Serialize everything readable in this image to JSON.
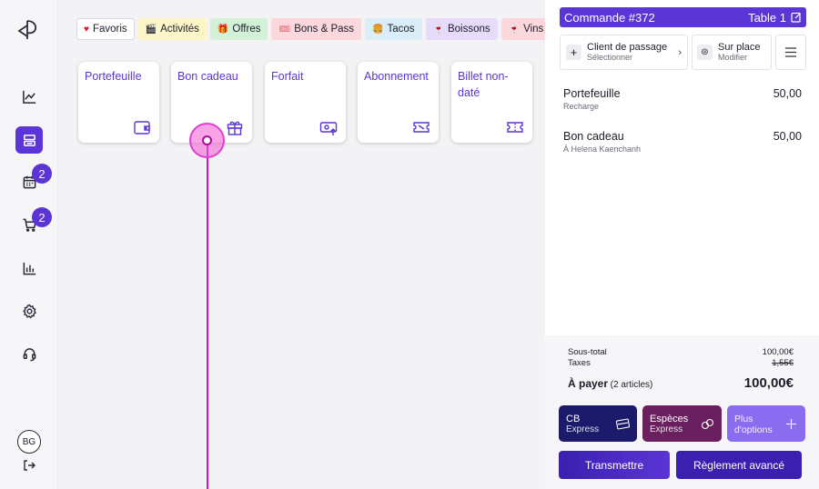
{
  "sidebar": {
    "badges": {
      "calendar": "2",
      "cart": "2"
    },
    "avatar": "BG"
  },
  "tabs": [
    {
      "emoji": "♥",
      "label": "Favoris",
      "bg": "#ffffff",
      "border": "#d9d9e3",
      "emoji_color": "#d11f2a"
    },
    {
      "emoji": "🎬",
      "label": "Activités",
      "bg": "#fdf6c8",
      "border": "#fdf6c8",
      "emoji_color": "#333"
    },
    {
      "emoji": "🎁",
      "label": "Offres",
      "bg": "#d3f1d8",
      "border": "#d3f1d8",
      "emoji_color": "#c8442a"
    },
    {
      "emoji": "🎟",
      "label": "Bons & Pass",
      "bg": "#fcd8dc",
      "border": "#fcd8dc",
      "emoji_color": "#d03b4c"
    },
    {
      "emoji": "🍔",
      "label": "Tacos",
      "bg": "#d9eef8",
      "border": "#d9eef8",
      "emoji_color": "#c08020"
    },
    {
      "emoji": "🍷",
      "label": "Boissons",
      "bg": "#e6dcfa",
      "border": "#e6dcfa",
      "emoji_color": "#a02040"
    },
    {
      "emoji": "🍷",
      "label": "Vins",
      "bg": "#fcd8dc",
      "border": "#fcd8dc",
      "emoji_color": "#a02040"
    }
  ],
  "products": [
    {
      "label": "Portefeuille",
      "icon": "wallet-icon"
    },
    {
      "label": "Bon cadeau",
      "icon": "gift-icon"
    },
    {
      "label": "Forfait",
      "icon": "cash-upload-icon"
    },
    {
      "label": "Abonnement",
      "icon": "ticket-icon"
    },
    {
      "label": "Billet non-daté",
      "icon": "ticket-dashed-icon"
    }
  ],
  "order": {
    "title": "Commande #372",
    "table": "Table 1",
    "client_title": "Client de passage",
    "client_sub": "Sélectionner",
    "place_title": "Sur place",
    "place_sub": "Modifier",
    "items": [
      {
        "name": "Portefeuille",
        "price": "50,00",
        "sub": "Recharge"
      },
      {
        "name": "Bon cadeau",
        "price": "50,00",
        "sub": "À Helena Kaenchanh"
      }
    ],
    "subtotal_label": "Sous-total",
    "subtotal_value": "100,00€",
    "taxes_label": "Taxes",
    "taxes_value": "1,55€",
    "pay_label": "À payer",
    "pay_count": "(2 articles)",
    "pay_value": "100,00€"
  },
  "payment": {
    "cb_title": "CB",
    "cb_sub": "Express",
    "cash_title": "Espèces",
    "cash_sub": "Express",
    "more_title": "Plus",
    "more_sub": "d'options",
    "transmit": "Transmettre",
    "advanced": "Règlement avancé"
  },
  "colors": {
    "accent": "#5b35d5",
    "cb_bg": "#1c1a6b",
    "cash_bg": "#6a1f5e",
    "more_bg": "#8a6cf0",
    "touch": "#d914c6"
  }
}
